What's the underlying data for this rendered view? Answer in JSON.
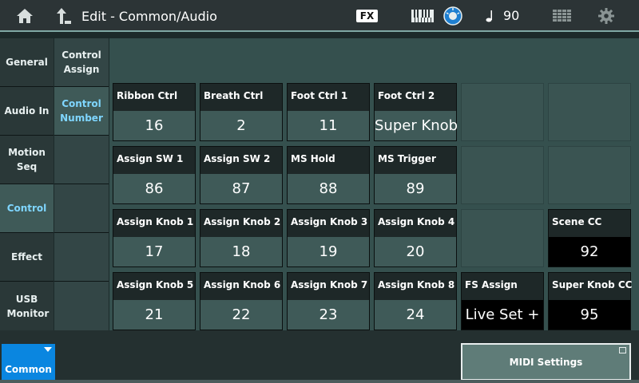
{
  "header": {
    "title": "Edit - Common/Audio",
    "fx_label": "FX",
    "tempo_value": "90",
    "icons": [
      "home-icon",
      "back-up-arrow-icon",
      "keyboard-icon",
      "dial-icon",
      "note-icon",
      "grid-icon",
      "gear-icon"
    ],
    "accent_color": "#7fd6ff"
  },
  "left_tabs": [
    {
      "label": "General"
    },
    {
      "label": "Audio In"
    },
    {
      "label": "Motion Seq"
    },
    {
      "label": "Control",
      "active": true
    },
    {
      "label": "Effect"
    },
    {
      "label": "USB Monitor"
    }
  ],
  "sub_tabs": [
    {
      "label": "Control Assign"
    },
    {
      "label": "Control Number",
      "active": true
    }
  ],
  "grid": {
    "row1": [
      {
        "label": "Ribbon Ctrl",
        "value": "16"
      },
      {
        "label": "Breath Ctrl",
        "value": "2"
      },
      {
        "label": "Foot Ctrl 1",
        "value": "11"
      },
      {
        "label": "Foot Ctrl 2",
        "value": "Super Knob"
      }
    ],
    "row2": [
      {
        "label": "Assign SW 1",
        "value": "86"
      },
      {
        "label": "Assign SW 2",
        "value": "87"
      },
      {
        "label": "MS Hold",
        "value": "88"
      },
      {
        "label": "MS Trigger",
        "value": "89"
      }
    ],
    "row3": [
      {
        "label": "Assign Knob 1",
        "value": "17"
      },
      {
        "label": "Assign Knob 2",
        "value": "18"
      },
      {
        "label": "Assign Knob 3",
        "value": "19"
      },
      {
        "label": "Assign Knob 4",
        "value": "20"
      },
      {
        "label": "Scene CC",
        "value": "92"
      }
    ],
    "row4": [
      {
        "label": "Assign Knob 5",
        "value": "21"
      },
      {
        "label": "Assign Knob 6",
        "value": "22"
      },
      {
        "label": "Assign Knob 7",
        "value": "23"
      },
      {
        "label": "Assign Knob 8",
        "value": "24"
      },
      {
        "label": "FS Assign",
        "value": "Live Set +"
      },
      {
        "label": "Super Knob CC",
        "value": "95"
      }
    ]
  },
  "footer": {
    "common_label": "Common",
    "midi_settings_label": "MIDI Settings"
  }
}
